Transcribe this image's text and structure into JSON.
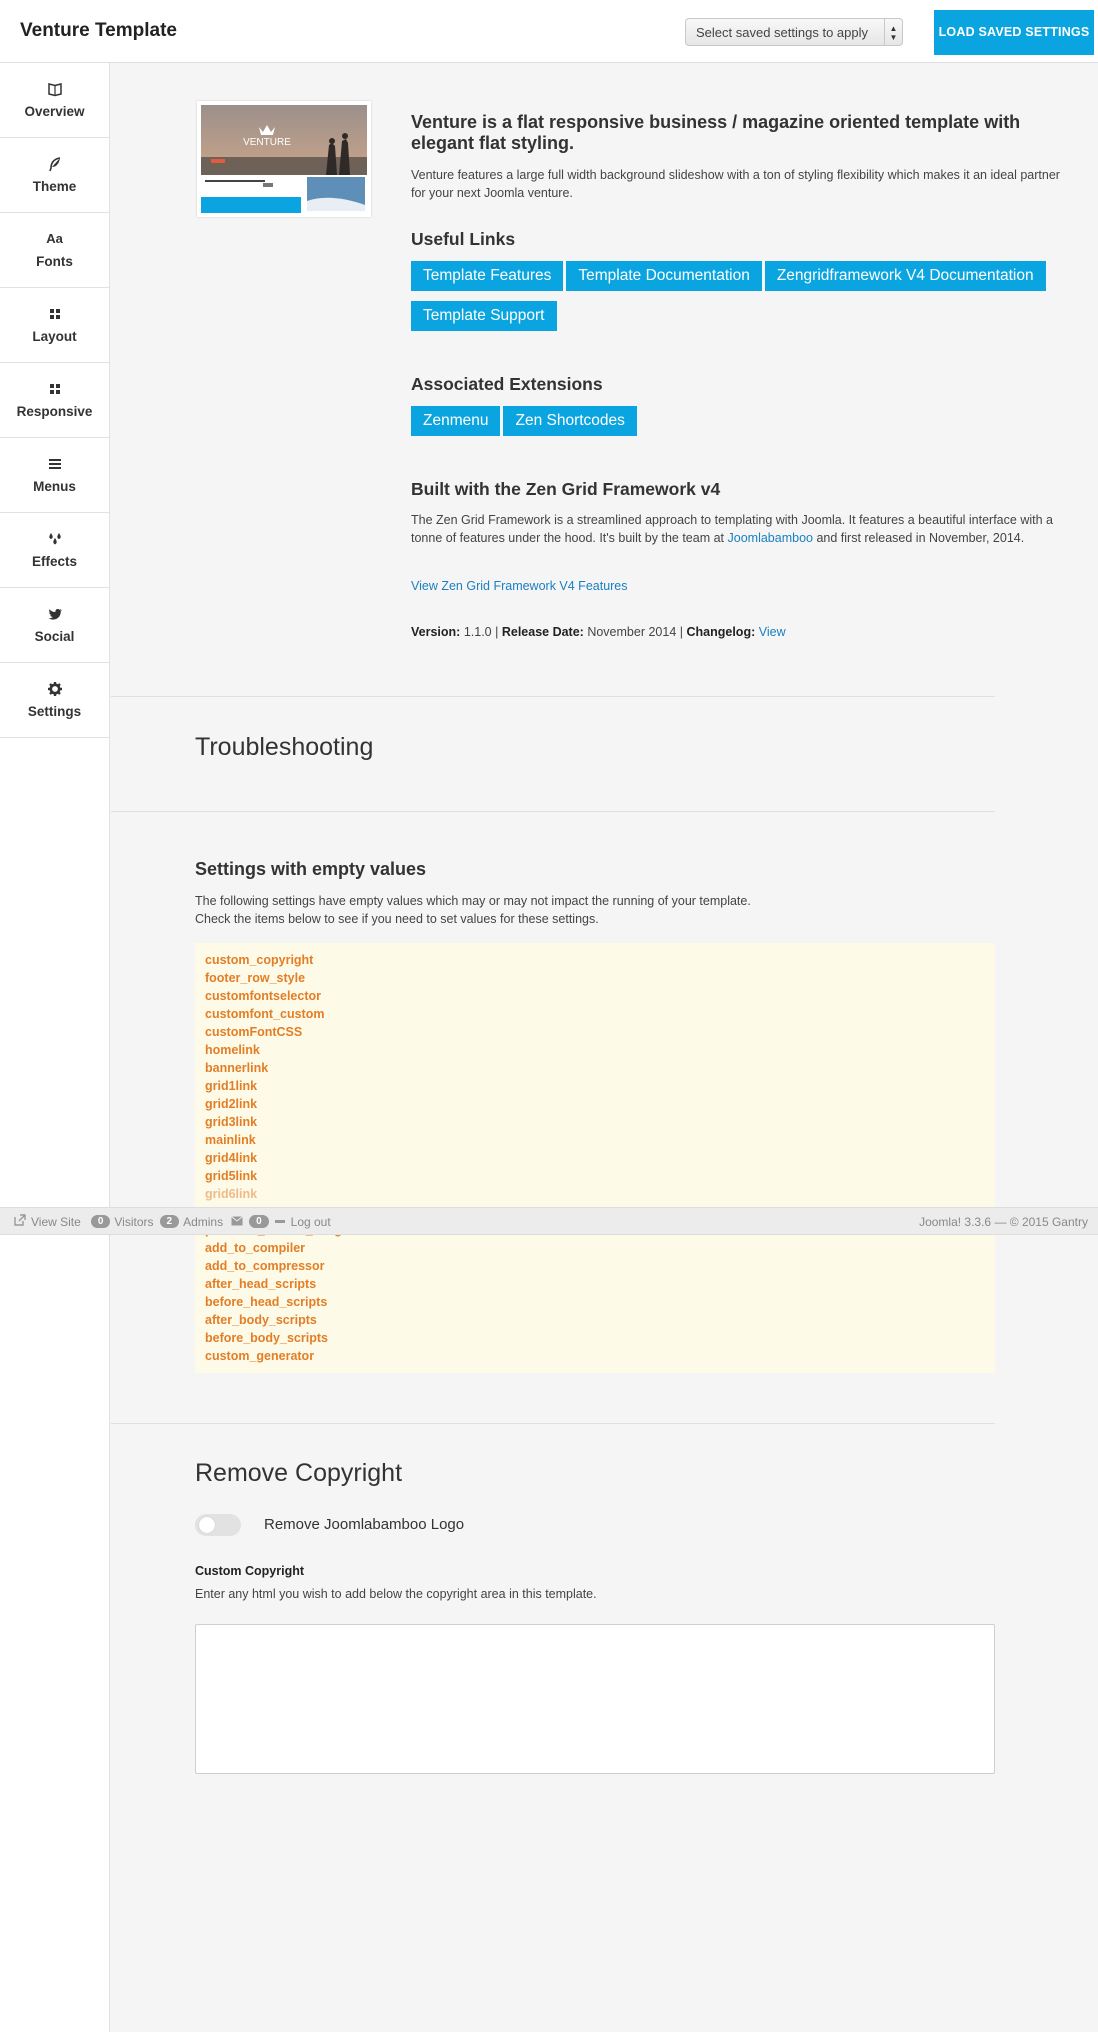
{
  "header": {
    "title": "Venture Template",
    "select_placeholder": "Select saved settings to apply",
    "load_button": "LOAD SAVED SETTINGS"
  },
  "sidebar": {
    "items": [
      {
        "label": "Overview",
        "icon": "book-icon"
      },
      {
        "label": "Theme",
        "icon": "feather-icon"
      },
      {
        "label": "Fonts",
        "icon": "font-icon"
      },
      {
        "label": "Layout",
        "icon": "grid-icon"
      },
      {
        "label": "Responsive",
        "icon": "grid-icon"
      },
      {
        "label": "Menus",
        "icon": "menu-icon"
      },
      {
        "label": "Effects",
        "icon": "drops-icon"
      },
      {
        "label": "Social",
        "icon": "twitter-icon"
      },
      {
        "label": "Settings",
        "icon": "gear-icon"
      }
    ]
  },
  "overview": {
    "headline": "Venture is a flat responsive business / magazine oriented template with elegant flat styling.",
    "description": "Venture features a large full width background slideshow with a ton of styling flexibility which makes it an ideal partner for your next Joomla venture.",
    "thumbnail_text": "VENTURE",
    "useful_links_title": "Useful Links",
    "useful_links": [
      "Template Features",
      "Template Documentation",
      "Zengridframework V4 Documentation",
      "Template Support"
    ],
    "extensions_title": "Associated Extensions",
    "extensions": [
      "Zenmenu",
      "Zen Shortcodes"
    ],
    "framework_title": "Built with the Zen Grid Framework v4",
    "framework_text_1": "The Zen Grid Framework is a streamlined approach to templating with Joomla. It features a beautiful interface with a tonne of features under the hood. It's built by the team at",
    "framework_link": "Joomlabamboo",
    "framework_text_2": "and first released in November, 2014.",
    "view_features_link": "View Zen Grid Framework V4 Features",
    "version_label": "Version:",
    "version_value": "1.1.0",
    "release_label": "Release Date:",
    "release_value": "November 2014",
    "changelog_label": "Changelog:",
    "changelog_link": "View",
    "separator": "|"
  },
  "troubleshooting": {
    "title": "Troubleshooting",
    "empty_title": "Settings with empty values",
    "empty_desc_1": "The following settings have empty values which may or may not impact the running of your template.",
    "empty_desc_2": "Check the items below to see if you need to set values for these settings.",
    "items_top": [
      "custom_copyright",
      "footer_row_style",
      "customfontselector",
      "customfont_custom",
      "customFontCSS",
      "homelink",
      "bannerlink",
      "grid1link",
      "grid2link",
      "grid3link",
      "mainlink",
      "grid4link",
      "grid5link",
      "grid6link"
    ],
    "items_partial": "pinterest_default_image",
    "items_bottom": [
      "add_to_compiler",
      "add_to_compressor",
      "after_head_scripts",
      "before_head_scripts",
      "after_body_scripts",
      "before_body_scripts",
      "custom_generator"
    ]
  },
  "statusbar": {
    "view_site": "View Site",
    "visitors_count": "0",
    "visitors_label": "Visitors",
    "admins_count": "2",
    "admins_label": "Admins",
    "messages_count": "0",
    "logout": "Log out",
    "right_text": "Joomla! 3.3.6  —  © 2015 Gantry"
  },
  "copyright": {
    "title": "Remove Copyright",
    "toggle_label": "Remove Joomlabamboo Logo",
    "field_label": "Custom Copyright",
    "field_help": "Enter any html you wish to add below the copyright area in this template.",
    "field_value": ""
  },
  "colors": {
    "accent": "#0aa5e0",
    "link": "#1a7fc1",
    "warning_text": "#e37e26",
    "warning_bg": "#fdfae8"
  }
}
